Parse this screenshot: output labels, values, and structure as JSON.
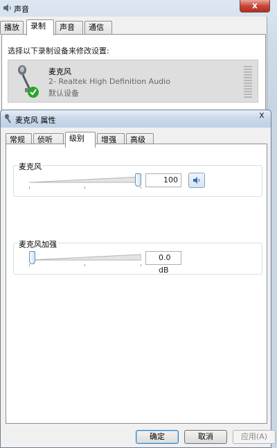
{
  "bg_window": {
    "title": "声音",
    "close_glyph": "x",
    "tabs": [
      {
        "label": "播放",
        "active": false
      },
      {
        "label": "录制",
        "active": true
      },
      {
        "label": "声音",
        "active": false
      },
      {
        "label": "通信",
        "active": false
      }
    ],
    "instruction": "选择以下录制设备来修改设置:",
    "device": {
      "name": "麦克风",
      "description": "2- Realtek High Definition Audio",
      "status": "默认设备",
      "icon": "microphone-icon",
      "badge_icon": "default-check-icon",
      "badge_color": "#2aa52a"
    }
  },
  "dialog": {
    "title": "麦克风 属性",
    "close_glyph": "x",
    "tabs": [
      {
        "label": "常规",
        "active": false
      },
      {
        "label": "侦听",
        "active": false
      },
      {
        "label": "级别",
        "active": true
      },
      {
        "label": "增强",
        "active": false
      },
      {
        "label": "高级",
        "active": false
      }
    ],
    "microphone": {
      "label": "麦克风",
      "level_fraction": 1.0,
      "value": "100",
      "speaker_icon": "speaker-icon"
    },
    "boost": {
      "label": "麦克风加强",
      "level_fraction": 0.0,
      "value": "0.0 dB"
    },
    "buttons": {
      "ok": "确定",
      "cancel": "取消",
      "apply": "应用(A)"
    }
  }
}
